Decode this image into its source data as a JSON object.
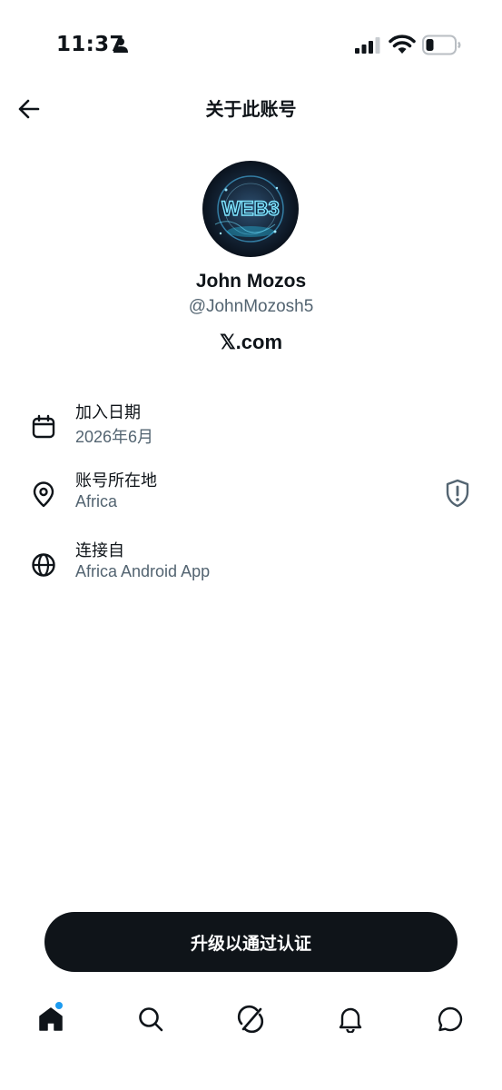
{
  "status_bar": {
    "time": "11:37"
  },
  "header": {
    "title": "关于此账号"
  },
  "profile": {
    "avatar_text": "WEB3",
    "name": "John Mozos",
    "handle": "@JohnMozosh5",
    "site": "𝕏.com"
  },
  "info": [
    {
      "label": "加入日期",
      "value": "2026年6月",
      "icon": "calendar-icon"
    },
    {
      "label": "账号所在地",
      "value": "Africa",
      "icon": "location-pin-icon"
    },
    {
      "label": "连接自",
      "value": "Africa Android App",
      "icon": "globe-icon"
    }
  ],
  "upgrade": {
    "label": "升级以通过认证"
  },
  "nav": {
    "items": [
      "home-icon",
      "search-icon",
      "grok-icon",
      "notifications-icon",
      "messages-icon"
    ],
    "home_has_unread_dot": true
  },
  "colors": {
    "text": "#0f1419",
    "secondary": "#536471",
    "accent": "#1d9bf0",
    "button": "#0f1419"
  }
}
